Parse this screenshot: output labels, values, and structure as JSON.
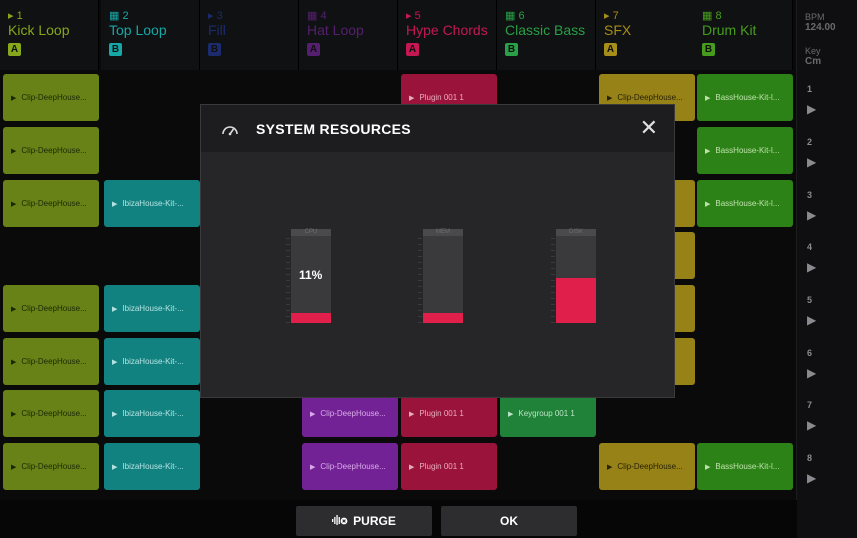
{
  "tracks": [
    {
      "num": "1",
      "name": "Kick Loop",
      "badge": "A",
      "color": "#8fb01f",
      "dim": false
    },
    {
      "num": "2",
      "name": "Top Loop",
      "badge": "B",
      "color": "#18b1b0",
      "dim": false
    },
    {
      "num": "3",
      "name": "Fill",
      "badge": "B",
      "color": "#2a48c7",
      "dim": true
    },
    {
      "num": "4",
      "name": "Hat Loop",
      "badge": "A",
      "color": "#9a2ec8",
      "dim": true
    },
    {
      "num": "5",
      "name": "Hype Chords",
      "badge": "A",
      "color": "#d01a57",
      "dim": false
    },
    {
      "num": "6",
      "name": "Classic Bass",
      "badge": "B",
      "color": "#2ca84b",
      "dim": false
    },
    {
      "num": "7",
      "name": "SFX",
      "badge": "A",
      "color": "#b0961a",
      "dim": false
    },
    {
      "num": "8",
      "name": "Drum Kit",
      "badge": "B",
      "color": "#4aa61f",
      "dim": false
    }
  ],
  "side": {
    "bpm_label": "BPM",
    "bpm_value": "124.00",
    "key_label": "Key",
    "key_value": "Cm"
  },
  "scenes": [
    "1",
    "2",
    "3",
    "4",
    "5",
    "6",
    "7",
    "8"
  ],
  "clips": [
    {
      "col": 0,
      "row": 0,
      "text": "Clip-DeepHouse...",
      "color": "#6f8a1a",
      "fg": "#1e2a05"
    },
    {
      "col": 4,
      "row": 0,
      "text": "Plugin 001 1",
      "color": "#a3153f",
      "fg": "#f4b6c8"
    },
    {
      "col": 6,
      "row": 0,
      "text": "Clip-DeepHouse...",
      "color": "#a0891a",
      "fg": "#2a2505"
    },
    {
      "col": 7,
      "row": 0,
      "text": "BassHouse-Kit-l...",
      "color": "#2f8a18",
      "fg": "#c9efb6"
    },
    {
      "col": 0,
      "row": 1,
      "text": "Clip-DeepHouse...",
      "color": "#6f8a1a",
      "fg": "#1e2a05"
    },
    {
      "col": 7,
      "row": 1,
      "text": "BassHouse-Kit-l...",
      "color": "#2f8a18",
      "fg": "#c9efb6"
    },
    {
      "col": 0,
      "row": 2,
      "text": "Clip-DeepHouse...",
      "color": "#6f8a1a",
      "fg": "#1e2a05"
    },
    {
      "col": 1,
      "row": 2,
      "text": "IbizaHouse-Kit-...",
      "color": "#138988",
      "fg": "#bff0ef"
    },
    {
      "col": 6,
      "row": 2,
      "text": "e...",
      "color": "#a0891a",
      "fg": "#2a2505"
    },
    {
      "col": 7,
      "row": 2,
      "text": "BassHouse-Kit-l...",
      "color": "#2f8a18",
      "fg": "#c9efb6"
    },
    {
      "col": 6,
      "row": 3,
      "text": "e...",
      "color": "#a0891a",
      "fg": "#2a2505"
    },
    {
      "col": 0,
      "row": 4,
      "text": "Clip-DeepHouse...",
      "color": "#6f8a1a",
      "fg": "#1e2a05"
    },
    {
      "col": 1,
      "row": 4,
      "text": "IbizaHouse-Kit-...",
      "color": "#138988",
      "fg": "#bff0ef"
    },
    {
      "col": 6,
      "row": 4,
      "text": "e...",
      "color": "#a0891a",
      "fg": "#2a2505"
    },
    {
      "col": 0,
      "row": 5,
      "text": "Clip-DeepHouse...",
      "color": "#6f8a1a",
      "fg": "#1e2a05"
    },
    {
      "col": 1,
      "row": 5,
      "text": "IbizaHouse-Kit-...",
      "color": "#138988",
      "fg": "#bff0ef"
    },
    {
      "col": 6,
      "row": 5,
      "text": "e...",
      "color": "#a0891a",
      "fg": "#2a2505"
    },
    {
      "col": 0,
      "row": 6,
      "text": "Clip-DeepHouse...",
      "color": "#6f8a1a",
      "fg": "#1e2a05"
    },
    {
      "col": 1,
      "row": 6,
      "text": "IbizaHouse-Kit-...",
      "color": "#138988",
      "fg": "#bff0ef"
    },
    {
      "col": 3,
      "row": 6,
      "text": "Clip-DeepHouse...",
      "color": "#7a249e",
      "fg": "#e3b6f5"
    },
    {
      "col": 4,
      "row": 6,
      "text": "Plugin 001 1",
      "color": "#a3153f",
      "fg": "#f4b6c8"
    },
    {
      "col": 5,
      "row": 6,
      "text": "Keygroup 001 1",
      "color": "#218a3c",
      "fg": "#c6f0d0"
    },
    {
      "col": 0,
      "row": 7,
      "text": "Clip-DeepHouse...",
      "color": "#6f8a1a",
      "fg": "#1e2a05"
    },
    {
      "col": 1,
      "row": 7,
      "text": "IbizaHouse-Kit-...",
      "color": "#138988",
      "fg": "#bff0ef"
    },
    {
      "col": 3,
      "row": 7,
      "text": "Clip-DeepHouse...",
      "color": "#7a249e",
      "fg": "#e3b6f5"
    },
    {
      "col": 4,
      "row": 7,
      "text": "Plugin 001 1",
      "color": "#a3153f",
      "fg": "#f4b6c8"
    },
    {
      "col": 6,
      "row": 7,
      "text": "Clip-DeepHouse...",
      "color": "#a0891a",
      "fg": "#2a2505"
    },
    {
      "col": 7,
      "row": 7,
      "text": "BassHouse-Kit-l...",
      "color": "#2f8a18",
      "fg": "#c9efb6"
    }
  ],
  "dialog": {
    "title": "SYSTEM RESOURCES",
    "icon": "gauge-icon",
    "close_icon": "close-icon",
    "meters": [
      {
        "label": "CPU",
        "value": 0.11,
        "value_text": "11%"
      },
      {
        "label": "MEM",
        "value": 0.12,
        "value_text": ""
      },
      {
        "label": "DISK",
        "value": 0.52,
        "value_text": ""
      }
    ]
  },
  "buttons": {
    "purge": "PURGE",
    "ok": "OK"
  },
  "accent": "#e0204a"
}
